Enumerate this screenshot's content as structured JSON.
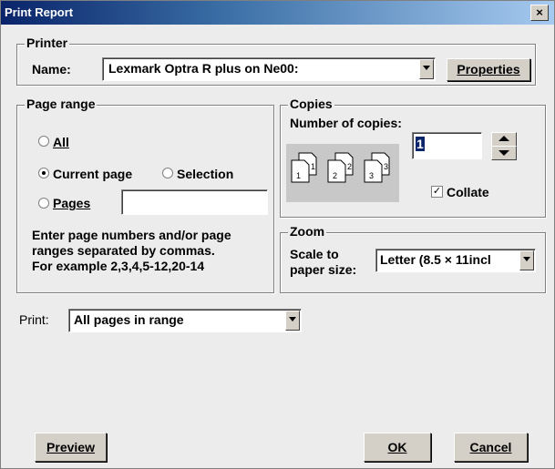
{
  "window": {
    "title": "Print Report",
    "close_symbol": "×"
  },
  "printer": {
    "group_label": "Printer",
    "name_label": "Name:",
    "name_value": "Lexmark Optra R plus on Ne00:",
    "properties_button": "Properties"
  },
  "page_range": {
    "group_label": "Page range",
    "all_label": "All",
    "current_label": "Current page",
    "selection_label": "Selection",
    "pages_label": "Pages",
    "pages_value": "",
    "selected": "current",
    "hint": "Enter page numbers and/or page\nranges separated by commas.\nFor example 2,3,4,5-12,20-14"
  },
  "copies": {
    "group_label": "Copies",
    "number_label": "Number of copies:",
    "number_value": "1",
    "collate_label": "Collate",
    "collate_checked": true,
    "page_numbers": [
      "1",
      "1",
      "2",
      "2",
      "3",
      "3"
    ]
  },
  "zoom": {
    "group_label": "Zoom",
    "scale_label": "Scale to\npaper size:",
    "scale_value": "Letter (8.5 × 11incl"
  },
  "print": {
    "label": "Print:",
    "value": "All pages in range"
  },
  "buttons": {
    "preview": "Preview",
    "ok": "OK",
    "cancel": "Cancel"
  }
}
